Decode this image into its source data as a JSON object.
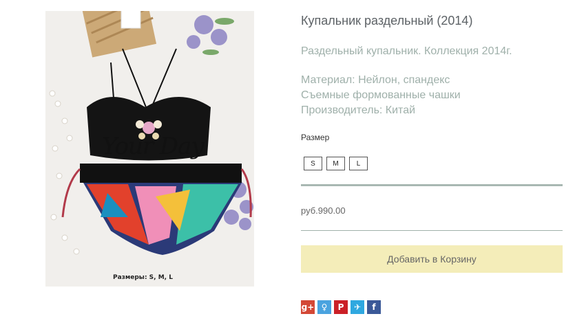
{
  "product": {
    "title": "Купальник раздельный (2014)",
    "summary": "Раздельный купальник. Коллекция 2014г.",
    "details": [
      "Материал: Нейлон, спандекс",
      "Съемные формованные чашки",
      "Производитель: Китай"
    ],
    "image": {
      "watermark": "Your Day",
      "caption": "Размеры: S, M, L"
    }
  },
  "size": {
    "label": "Размер",
    "options": [
      "S",
      "M",
      "L"
    ]
  },
  "price": "руб.990.00",
  "add_to_cart_label": "Добавить в Корзину",
  "share": {
    "icons": [
      {
        "name": "google-plus-icon",
        "glyph": "g+",
        "color": "#d34836"
      },
      {
        "name": "odnoklassniki-icon",
        "glyph": "♀",
        "color": "#4aa3df"
      },
      {
        "name": "pinterest-icon",
        "glyph": "P",
        "color": "#cb2027"
      },
      {
        "name": "twitter-icon",
        "glyph": "✈",
        "color": "#2fa8e0"
      },
      {
        "name": "facebook-icon",
        "glyph": "f",
        "color": "#3b5998"
      }
    ]
  }
}
